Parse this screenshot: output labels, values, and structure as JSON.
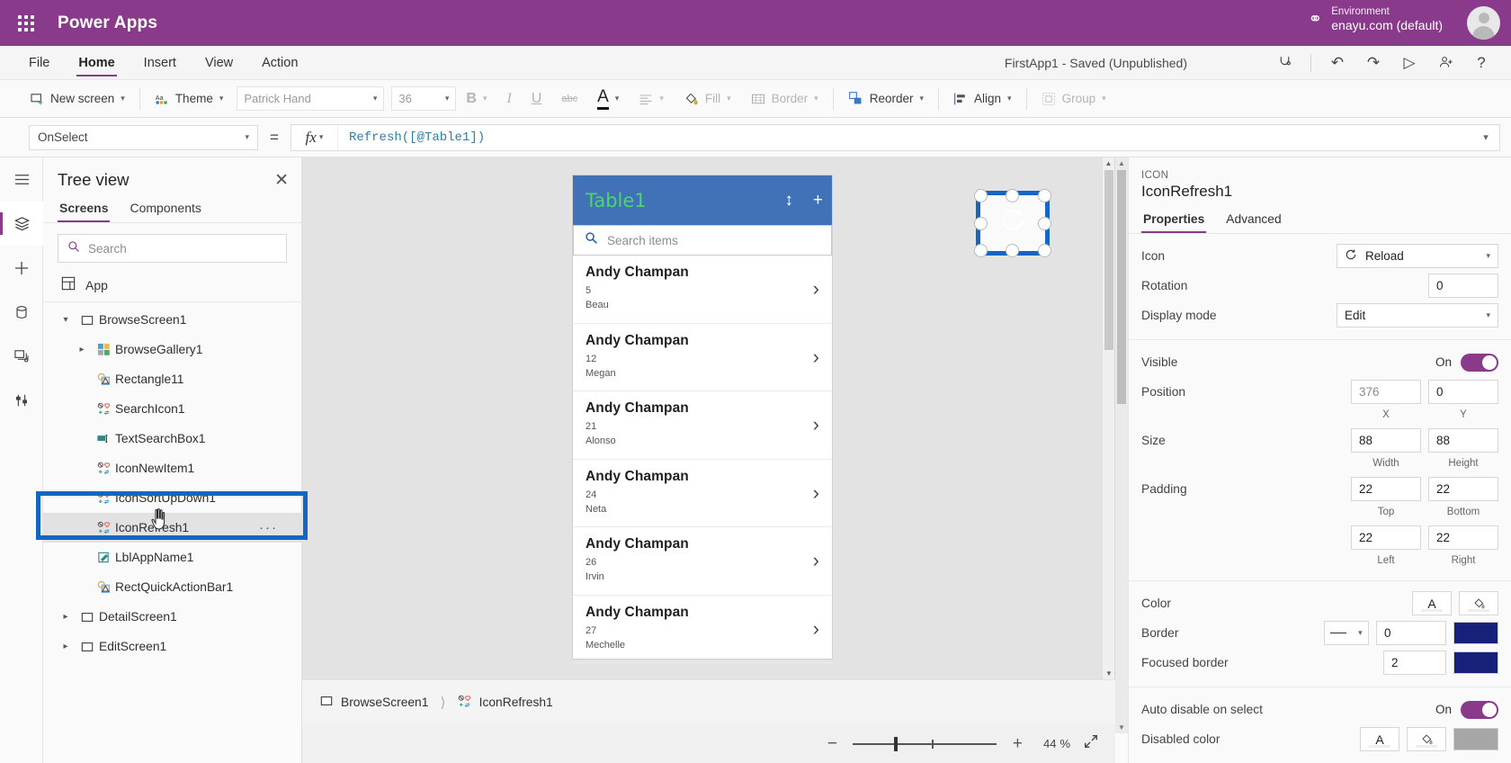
{
  "topbar": {
    "waffle_icon": "app-launcher-icon",
    "brand": "Power Apps",
    "environment_label": "Environment",
    "environment_name": "enayu.com (default)",
    "globe_icon": "globe-icon",
    "avatar_icon": "user-avatar"
  },
  "menu": {
    "items": [
      {
        "label": "File"
      },
      {
        "label": "Home"
      },
      {
        "label": "Insert"
      },
      {
        "label": "View"
      },
      {
        "label": "Action"
      }
    ],
    "app_status": "FirstApp1 - Saved (Unpublished)",
    "icons": [
      {
        "name": "app-checker-icon",
        "glyph": "⚕"
      },
      {
        "name": "undo-icon",
        "glyph": "↶"
      },
      {
        "name": "redo-icon",
        "glyph": "↷"
      },
      {
        "name": "preview-icon",
        "glyph": "▷"
      },
      {
        "name": "share-icon",
        "glyph": "☺"
      },
      {
        "name": "help-icon",
        "glyph": "?"
      }
    ]
  },
  "ribbon": {
    "new_screen": "New screen",
    "theme": "Theme",
    "font_family": "Patrick Hand",
    "font_size": "36",
    "bold": "B",
    "italic": "I",
    "underline": "U",
    "strike": "abc",
    "font_color": "A",
    "align": "align-left",
    "fill": "Fill",
    "border": "Border",
    "reorder": "Reorder",
    "align_menu": "Align",
    "group": "Group"
  },
  "formula_bar": {
    "property": "OnSelect",
    "equals": "=",
    "fx": "fx",
    "formula_tokens": [
      {
        "text": "Refresh(",
        "kind": "blue"
      },
      {
        "text": "[@Table1]",
        "kind": "blue"
      },
      {
        "text": ")",
        "kind": "blue"
      }
    ],
    "formula_text": "Refresh([@Table1])"
  },
  "rail": {
    "items": [
      {
        "name": "hamburger-icon",
        "glyph": "☰",
        "selected": false
      },
      {
        "name": "tree-view-icon",
        "glyph": "☰",
        "selected": true
      },
      {
        "name": "insert-icon",
        "glyph": "+",
        "selected": false
      },
      {
        "name": "data-icon",
        "glyph": "⛃",
        "selected": false
      },
      {
        "name": "media-icon",
        "glyph": "❐",
        "selected": false
      },
      {
        "name": "settings-icon",
        "glyph": "⫶",
        "selected": false
      }
    ]
  },
  "treeview": {
    "title": "Tree view",
    "close_icon": "close-icon",
    "tabs": [
      {
        "label": "Screens",
        "active": true
      },
      {
        "label": "Components",
        "active": false
      }
    ],
    "search_placeholder": "Search",
    "search_value": "",
    "app_node": "App",
    "nodes": [
      {
        "label": "BrowseScreen1",
        "depth": 1,
        "expandable": true,
        "expanded": true,
        "icon": "screen-icon",
        "selected": false
      },
      {
        "label": "BrowseGallery1",
        "depth": 2,
        "expandable": true,
        "expanded": false,
        "icon": "gallery-icon",
        "selected": false
      },
      {
        "label": "Rectangle11",
        "depth": 2,
        "expandable": false,
        "icon": "shape-icon",
        "selected": false
      },
      {
        "label": "SearchIcon1",
        "depth": 2,
        "expandable": false,
        "icon": "icon-icon",
        "selected": false
      },
      {
        "label": "TextSearchBox1",
        "depth": 2,
        "expandable": false,
        "icon": "textbox-icon",
        "selected": false
      },
      {
        "label": "IconNewItem1",
        "depth": 2,
        "expandable": false,
        "icon": "icon-icon",
        "selected": false
      },
      {
        "label": "IconSortUpDown1",
        "depth": 2,
        "expandable": false,
        "icon": "icon-icon",
        "selected": false
      },
      {
        "label": "IconRefresh1",
        "depth": 2,
        "expandable": false,
        "icon": "icon-icon",
        "selected": true,
        "overflow": "···"
      },
      {
        "label": "LblAppName1",
        "depth": 2,
        "expandable": false,
        "icon": "label-icon",
        "selected": false
      },
      {
        "label": "RectQuickActionBar1",
        "depth": 2,
        "expandable": false,
        "icon": "shape-icon",
        "selected": false
      },
      {
        "label": "DetailScreen1",
        "depth": 1,
        "expandable": true,
        "expanded": false,
        "icon": "screen-icon",
        "selected": false
      },
      {
        "label": "EditScreen1",
        "depth": 1,
        "expandable": true,
        "expanded": false,
        "icon": "screen-icon",
        "selected": false
      }
    ]
  },
  "canvas": {
    "app_title": "Table1",
    "header_icons": [
      {
        "name": "sort-icon",
        "glyph": "↕"
      },
      {
        "name": "add-icon",
        "glyph": "+"
      }
    ],
    "selected_icon": "reload-icon",
    "search_placeholder": "Search items",
    "search_icon": "search-icon",
    "gallery": [
      {
        "name": "Andy Champan",
        "number": "5",
        "sub": "Beau"
      },
      {
        "name": "Andy Champan",
        "number": "12",
        "sub": "Megan"
      },
      {
        "name": "Andy Champan",
        "number": "21",
        "sub": "Alonso"
      },
      {
        "name": "Andy Champan",
        "number": "24",
        "sub": "Neta"
      },
      {
        "name": "Andy Champan",
        "number": "26",
        "sub": "Irvin"
      },
      {
        "name": "Andy Champan",
        "number": "27",
        "sub": "Mechelle"
      }
    ],
    "chevron": "›"
  },
  "statusbar": {
    "breadcrumb": [
      {
        "label": "BrowseScreen1",
        "icon": "screen-icon"
      },
      {
        "label": "IconRefresh1",
        "icon": "icon-icon"
      }
    ],
    "zoom_out": "−",
    "zoom_in": "+",
    "zoom_value": "44",
    "zoom_unit": "%",
    "fit_icon": "expand-icon"
  },
  "properties": {
    "kind": "ICON",
    "name": "IconRefresh1",
    "tabs": [
      {
        "label": "Properties",
        "active": true
      },
      {
        "label": "Advanced",
        "active": false
      }
    ],
    "icon_label": "Icon",
    "icon_value": "Reload",
    "rotation_label": "Rotation",
    "rotation_value": "0",
    "display_mode_label": "Display mode",
    "display_mode_value": "Edit",
    "visible_label": "Visible",
    "visible_state": "On",
    "position_label": "Position",
    "position_x": "376",
    "position_y": "0",
    "position_x_label": "X",
    "position_y_label": "Y",
    "size_label": "Size",
    "size_width": "88",
    "size_height": "88",
    "size_width_label": "Width",
    "size_height_label": "Height",
    "padding_label": "Padding",
    "padding_top": "22",
    "padding_bottom": "22",
    "padding_left": "22",
    "padding_right": "22",
    "padding_top_label": "Top",
    "padding_bottom_label": "Bottom",
    "padding_left_label": "Left",
    "padding_right_label": "Right",
    "color_label": "Color",
    "color_text_btn": "A",
    "border_label": "Border",
    "border_width": "0",
    "border_color": "#16217a",
    "focused_border_label": "Focused border",
    "focused_border_width": "2",
    "focused_border_color": "#16217a",
    "auto_disable_label": "Auto disable on select",
    "auto_disable_state": "On",
    "disabled_color_label": "Disabled color",
    "disabled_color_text_btn": "A",
    "disabled_swatch": "#a6a6a6"
  },
  "colors": {
    "brand_purple": "#8a3a8a",
    "accent_blue": "#1566c0",
    "app_header_blue": "#4172b8",
    "app_title_green": "#4bd66a"
  }
}
